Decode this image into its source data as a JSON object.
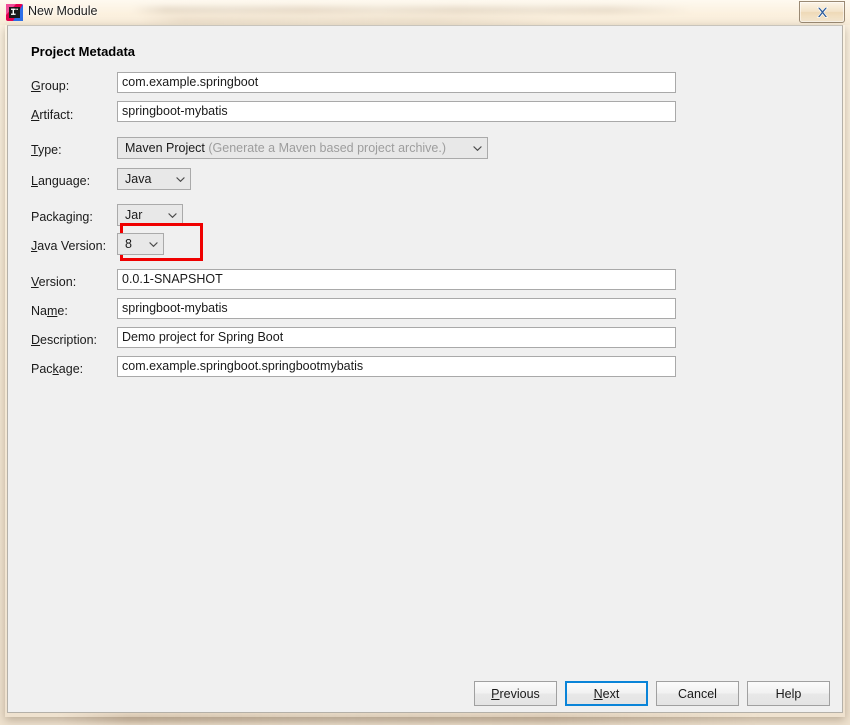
{
  "window": {
    "title": "New Module",
    "icon": "intellij-idea-icon",
    "close_label": "x"
  },
  "dialog": {
    "section_title": "Project Metadata",
    "fields": [
      {
        "label": "Group:",
        "mnemonic": "G",
        "type": "text",
        "value": "com.example.springboot"
      },
      {
        "label": "Artifact:",
        "mnemonic": "A",
        "type": "text",
        "value": "springboot-mybatis"
      },
      {
        "label": "Type:",
        "mnemonic": "T",
        "type": "combo",
        "value": "Maven Project",
        "hint": "(Generate a Maven based project archive.)"
      },
      {
        "label": "Language:",
        "mnemonic": "L",
        "type": "combo",
        "value": "Java"
      },
      {
        "label": "Packaging:",
        "mnemonic": "g",
        "type": "combo",
        "value": "Jar",
        "highlighted": true
      },
      {
        "label": "Java Version:",
        "mnemonic": "J",
        "type": "combo",
        "value": "8"
      },
      {
        "label": "Version:",
        "mnemonic": "V",
        "type": "text",
        "value": "0.0.1-SNAPSHOT"
      },
      {
        "label": "Name:",
        "mnemonic": "m",
        "type": "text",
        "value": "springboot-mybatis"
      },
      {
        "label": "Description:",
        "mnemonic": "D",
        "type": "text",
        "value": "Demo project for Spring Boot"
      },
      {
        "label": "Package:",
        "mnemonic": "k",
        "type": "text",
        "value": "com.example.springboot.springbootmybatis"
      }
    ],
    "labels": {
      "group": {
        "pre": "G",
        "mn": "",
        "post": "roup:"
      },
      "artifact": {
        "pre": "",
        "mn": "A",
        "post": "rtifact:"
      },
      "type": {
        "pre": "",
        "mn": "T",
        "post": "ype:"
      },
      "language": {
        "pre": "",
        "mn": "L",
        "post": "anguage:"
      },
      "packaging": {
        "pre": "Packa",
        "mn": "g",
        "post": "ing:"
      },
      "java_version": {
        "pre": "",
        "mn": "J",
        "post": "ava Version:"
      },
      "version": {
        "pre": "",
        "mn": "V",
        "post": "ersion:"
      },
      "name": {
        "pre": "Na",
        "mn": "m",
        "post": "e:"
      },
      "description": {
        "pre": "",
        "mn": "D",
        "post": "escription:"
      },
      "package": {
        "pre": "Pac",
        "mn": "k",
        "post": "age:"
      }
    },
    "values": {
      "group": "com.example.springboot",
      "artifact": "springboot-mybatis",
      "type": "Maven Project",
      "type_hint": "(Generate a Maven based project archive.)",
      "language": "Java",
      "packaging": "Jar",
      "java_version": "8",
      "version": "0.0.1-SNAPSHOT",
      "name": "springboot-mybatis",
      "description": "Demo project for Spring Boot",
      "package": "com.example.springboot.springbootmybatis"
    },
    "buttons": {
      "previous": {
        "pre": "",
        "mn": "P",
        "post": "revious"
      },
      "next": {
        "pre": "",
        "mn": "N",
        "post": "ext"
      },
      "cancel": {
        "pre": "Cancel",
        "mn": "",
        "post": ""
      },
      "help": {
        "pre": "Help",
        "mn": "",
        "post": ""
      }
    }
  },
  "annotation": {
    "highlight_color": "#ef0000",
    "highlight_target": "packaging-combo"
  },
  "colors": {
    "dialog_background": "#f0f0f0",
    "field_background": "#ffffff",
    "combo_background": "#e8e8e8",
    "default_button_border": "#0a84d8",
    "hint_text": "#9d9d9d"
  }
}
